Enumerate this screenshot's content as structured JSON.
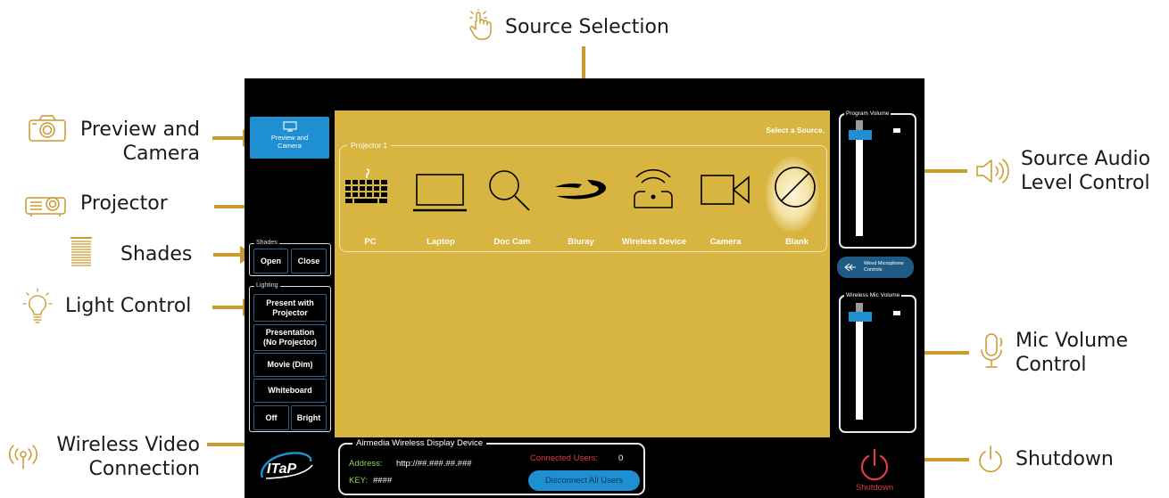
{
  "callouts": {
    "source_selection": "Source Selection",
    "preview_camera_1": "Preview and",
    "preview_camera_2": "Camera",
    "projector": "Projector",
    "shades": "Shades",
    "light_control": "Light Control",
    "wireless_video_1": "Wireless Video",
    "wireless_video_2": "Connection",
    "source_audio_1": "Source Audio",
    "source_audio_2": "Level Control",
    "mic_volume_1": "Mic Volume",
    "mic_volume_2": "Control",
    "shutdown": "Shutdown"
  },
  "panel": {
    "preview_button": {
      "line1": "Preview and",
      "line2": "Camera"
    },
    "select_prompt": "Select a Source.",
    "projector_group": "Projector 1",
    "sources": [
      {
        "label": "PC",
        "icon": "keyboard-icon"
      },
      {
        "label": "Laptop",
        "icon": "laptop-icon"
      },
      {
        "label": "Doc Cam",
        "icon": "magnifier-icon"
      },
      {
        "label": "Bluray",
        "icon": "bluray-icon"
      },
      {
        "label": "Wireless Device",
        "icon": "wireless-device-icon"
      },
      {
        "label": "Camera",
        "icon": "video-camera-icon"
      },
      {
        "label": "Blank",
        "icon": "blank-icon"
      }
    ],
    "shades": {
      "title": "Shades",
      "open": "Open",
      "close": "Close"
    },
    "lighting": {
      "title": "Lighting",
      "present_line1": "Present with",
      "present_line2": "Projector",
      "presentation_line1": "Presentation",
      "presentation_line2": "(No Projector)",
      "movie": "Movie (Dim)",
      "whiteboard": "Whiteboard",
      "off": "Off",
      "bright": "Bright"
    },
    "program_volume": {
      "title": "Program Volume",
      "level": 0.86
    },
    "wired_mic_button": {
      "line1": "Wired Microphone",
      "line2": "Controls"
    },
    "wireless_mic_volume": {
      "title": "Wireless Mic Volume",
      "level": 0.86
    },
    "airmedia": {
      "title": "Airmedia Wireless Display Device",
      "address_label": "Address:",
      "address_value": "http://##.###.##.###",
      "key_label": "KEY:",
      "key_value": "####",
      "connected_label": "Connected Users:",
      "connected_value": "0",
      "disconnect": "Disconnect All Users"
    },
    "shutdown_label": "Shutdown",
    "logo_text": "ITaP"
  },
  "colors": {
    "accent_gold": "#c99a2e",
    "stage_gold": "#d8b441",
    "button_blue": "#1e8fd0",
    "shutdown_red": "#e23a48",
    "address_green": "#8fd14f"
  }
}
